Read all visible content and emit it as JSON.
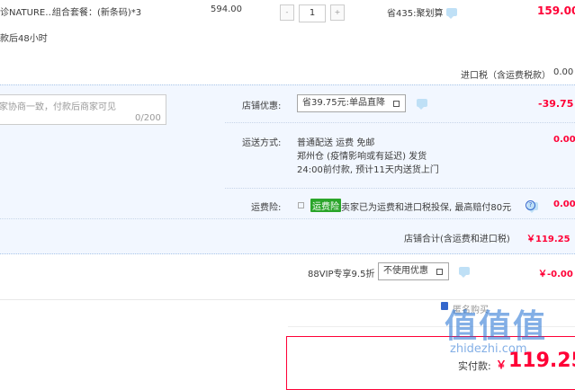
{
  "item": {
    "name": "诊NATURE…",
    "spec": "组合套餐：(新条码)*3",
    "note": "款后48小时",
    "unit_price": "594.00",
    "qty_minus": "-",
    "quantity": "1",
    "qty_plus": "+",
    "promo": "省435:聚划算",
    "subtotal": "159.00"
  },
  "tax": {
    "label": "进口税（含运费税款）",
    "value": "0.00"
  },
  "shop": {
    "memo_placeholder": "家协商一致，付款后商家可见",
    "memo_count": "0/200",
    "discount_label": "店铺优惠:",
    "discount_option": "省39.75元:单品直降",
    "discount_value": "-39.75",
    "shipping_label": "运送方式:",
    "shipping_line1": "普通配送 运费 免邮",
    "shipping_line2": "郑州仓 (疫情影响或有延迟)    发货",
    "shipping_line3": "24:00前付款, 预计11天内送货上门",
    "shipping_value": "0.00",
    "insurance_label": "运费险:",
    "insurance_badge": "运费险",
    "insurance_text": "卖家已为运费和进口税投保, 最高赔付80元",
    "insurance_help": "?",
    "insurance_value": "0.00",
    "total_label": "店铺合计(含运费和进口税)",
    "total_value": "￥119.25"
  },
  "vip": {
    "label": "88VIP专享9.5折",
    "option": "不使用优惠",
    "value": "￥-0.00"
  },
  "bottom": {
    "option_partial": "匿名购买",
    "pay_label": "实付款:",
    "pay_currency": "￥",
    "pay_value": "119.25"
  },
  "watermark": {
    "logo": "值值值",
    "site": "zhidezhi.com"
  },
  "colors": {
    "accent_red": "#ff0036",
    "panel_blue": "#f2f7ff",
    "badge_green": "#2aa52a"
  }
}
